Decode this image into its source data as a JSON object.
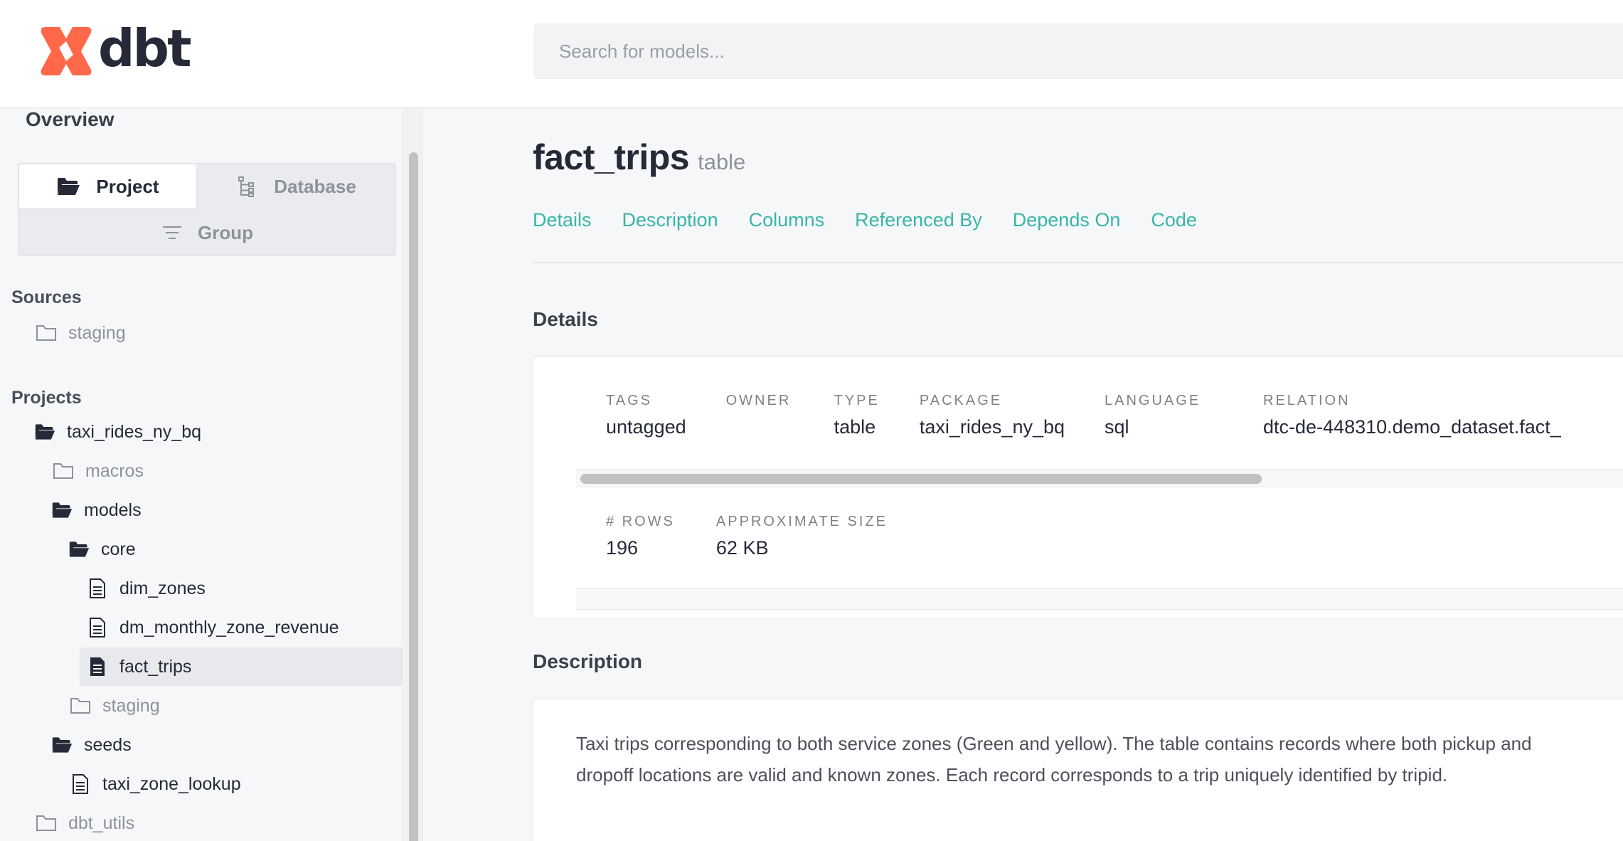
{
  "header": {
    "logo_text": "dbt",
    "search_placeholder": "Search for models...",
    "brand_color": "#ff694a"
  },
  "sidebar": {
    "overview_label": "Overview",
    "view_toggle": {
      "project_label": "Project",
      "database_label": "Database",
      "group_label": "Group",
      "selected": "Project"
    },
    "sources_title": "Sources",
    "sources": [
      {
        "label": "staging",
        "icon": "folder-closed-icon"
      }
    ],
    "projects_title": "Projects",
    "tree": {
      "root": "taxi_rides_ny_bq",
      "macros": "macros",
      "models": "models",
      "core": "core",
      "dim_zones": "dim_zones",
      "dm_monthly_zone_revenue": "dm_monthly_zone_revenue",
      "fact_trips": "fact_trips",
      "staging": "staging",
      "seeds": "seeds",
      "taxi_zone_lookup": "taxi_zone_lookup",
      "dbt_utils": "dbt_utils"
    }
  },
  "main": {
    "title": "fact_trips",
    "subtitle": "table",
    "tabs": [
      "Details",
      "Description",
      "Columns",
      "Referenced By",
      "Depends On",
      "Code"
    ],
    "details_heading": "Details",
    "details": {
      "tags_label": "TAGS",
      "tags_value": "untagged",
      "owner_label": "OWNER",
      "owner_value": "",
      "type_label": "TYPE",
      "type_value": "table",
      "package_label": "PACKAGE",
      "package_value": "taxi_rides_ny_bq",
      "language_label": "LANGUAGE",
      "language_value": "sql",
      "relation_label": "RELATION",
      "relation_value": "dtc-de-448310.demo_dataset.fact_",
      "rows_label": "# ROWS",
      "rows_value": "196",
      "size_label": "APPROXIMATE SIZE",
      "size_value": "62 KB"
    },
    "description_heading": "Description",
    "description": "Taxi trips corresponding to both service zones (Green and yellow). The table contains records where both pickup and dropoff locations are valid and known zones. Each record corresponds to a trip uniquely identified by tripid.",
    "accent_color": "#37b6a8"
  }
}
